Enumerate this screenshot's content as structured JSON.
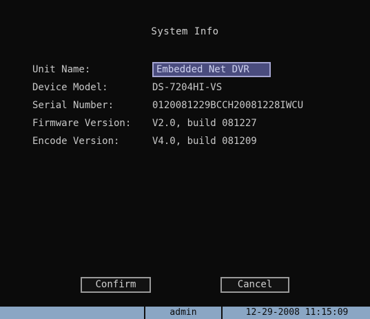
{
  "dialog": {
    "title": "System Info"
  },
  "fields": {
    "unit_name": {
      "label": "Unit Name:",
      "value": "Embedded Net DVR"
    },
    "device_model": {
      "label": "Device Model:",
      "value": "DS-7204HI-VS"
    },
    "serial_number": {
      "label": "Serial Number:",
      "value": "0120081229BCCH20081228IWCU"
    },
    "firmware_version": {
      "label": "Firmware Version:",
      "value": "V2.0, build 081227"
    },
    "encode_version": {
      "label": "Encode Version:",
      "value": "V4.0, build 081209"
    }
  },
  "buttons": {
    "confirm": "Confirm",
    "cancel": "Cancel"
  },
  "status_bar": {
    "user": "admin",
    "datetime": "12-29-2008 11:15:09"
  },
  "colors": {
    "background": "#0b0b0b",
    "text": "#c8c8c8",
    "input_fill": "#4a4c7e",
    "input_border": "#a5a5d2",
    "status_bar": "#8aa6c4"
  }
}
